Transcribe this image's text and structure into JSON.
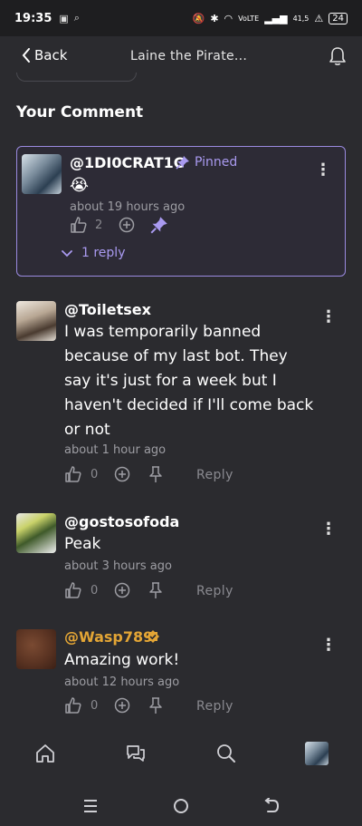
{
  "status_bar": {
    "time": "19:35",
    "battery": "24",
    "net_speed": "41,5\nK/S",
    "network": "Vo\nLTE"
  },
  "header": {
    "back_label": "Back",
    "title": "Laine the Pirate..."
  },
  "section_title": "Your Comment",
  "comments": [
    {
      "username": "@1DI0CRAT1C",
      "pinned_label": "Pinned",
      "text": "😭",
      "time": "about 19 hours ago",
      "likes": "2",
      "replies_label": "1 reply"
    },
    {
      "username": "@Toiletsex",
      "text_lines": [
        "I was temporarily banned",
        "because of my last bot. They",
        "say it's just for a week but I",
        "haven't decided if I'll come back",
        "or not"
      ],
      "time": "about 1 hour ago",
      "likes": "0",
      "reply_label": "Reply"
    },
    {
      "username": "@gostosofoda",
      "text": "Peak",
      "time": "about 3 hours ago",
      "likes": "0",
      "reply_label": "Reply"
    },
    {
      "username": "@Wasp789",
      "text": "Amazing work!",
      "time": "about 12 hours ago",
      "likes": "0",
      "reply_label": "Reply"
    }
  ],
  "colors": {
    "accent": "#a99af0",
    "background": "#2b2b2f",
    "verified": "#e3a535"
  }
}
